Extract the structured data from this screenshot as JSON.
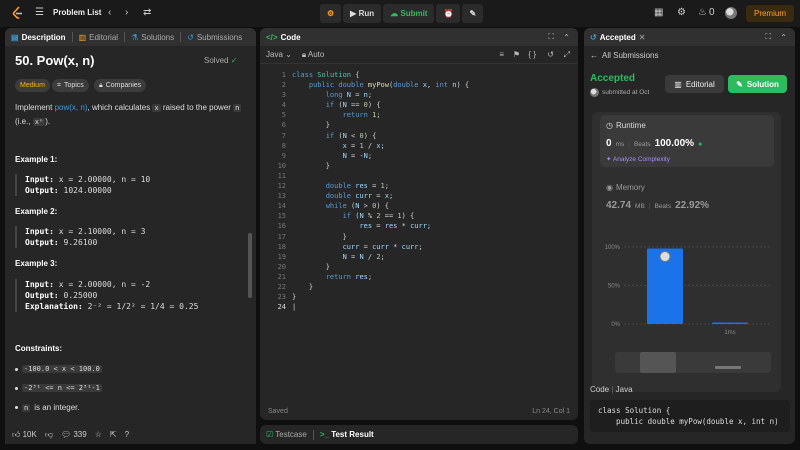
{
  "topbar": {
    "problem_list_label": "Problem List",
    "run_label": "Run",
    "submit_label": "Submit",
    "streak_count": "0",
    "premium_label": "Premium"
  },
  "description": {
    "tabs": [
      {
        "label": "Description",
        "active": true
      },
      {
        "label": "Editorial",
        "active": false
      },
      {
        "label": "Solutions",
        "active": false
      },
      {
        "label": "Submissions",
        "active": false
      }
    ],
    "title": "50. Pow(x, n)",
    "solved_label": "Solved",
    "chips": {
      "difficulty": "Medium",
      "topics": "Topics",
      "companies": "Companies"
    },
    "intro_prefix": "Implement",
    "intro_link": "pow(x, n)",
    "intro_mid": ", which calculates",
    "intro_x": "x",
    "intro_mid2": "raised to the power",
    "intro_n": "n",
    "intro_suffix_prefix": "(i.e.,",
    "intro_xn": "xⁿ",
    "intro_suffix": ").",
    "examples": [
      {
        "title": "Example 1:",
        "input": "x = 2.00000, n = 10",
        "output": "1024.00000",
        "explanation": ""
      },
      {
        "title": "Example 2:",
        "input": "x = 2.10000, n = 3",
        "output": "9.26100",
        "explanation": ""
      },
      {
        "title": "Example 3:",
        "input": "x = 2.00000, n = -2",
        "output": "0.25000",
        "explanation": "2⁻² = 1/2² = 1/4 = 0.25"
      }
    ],
    "labels": {
      "input": "Input:",
      "output": "Output:",
      "explanation": "Explanation:"
    },
    "constraints_title": "Constraints:",
    "constraints": [
      "-100.0 < x < 100.0",
      "-2³¹ <= n <= 2³¹-1",
      "is an integer."
    ],
    "constraint_n": "n",
    "footer": {
      "likes": "10K",
      "comments": "339"
    }
  },
  "code": {
    "tab_label": "Code",
    "language": "Java",
    "mode": "Auto",
    "saved_label": "Saved",
    "cursor_pos": "Ln 24, Col 1",
    "line_numbers": [
      "1",
      "2",
      "3",
      "4",
      "5",
      "6",
      "7",
      "8",
      "9",
      "10",
      "11",
      "12",
      "13",
      "14",
      "15",
      "16",
      "17",
      "18",
      "19",
      "20",
      "21",
      "22",
      "23",
      "24"
    ]
  },
  "bottom": {
    "testcase_label": "Testcase",
    "result_label": "Test Result"
  },
  "result": {
    "tab_label": "Accepted",
    "all_submissions": "All Submissions",
    "status": "Accepted",
    "submitted_at": "submitted at Oct",
    "editorial_btn": "Editorial",
    "solution_btn": "Solution",
    "runtime_label": "Runtime",
    "runtime_value": "0",
    "runtime_unit": "ms",
    "beats_label": "Beats",
    "runtime_beats": "100.00%",
    "analyze": "Analyze Complexity",
    "memory_label": "Memory",
    "memory_value": "42.74",
    "memory_unit": "MB",
    "memory_beats": "22.92%",
    "code_header_label": "Code",
    "code_header_lang": "Java",
    "code_preview": "class Solution {\n    public double myPow(double x, int n)"
  },
  "chart_data": {
    "type": "bar",
    "categories": [
      "0ms",
      "1ms"
    ],
    "values": [
      98,
      2
    ],
    "yticks": [
      "100%",
      "50%",
      "0%"
    ],
    "ylim": [
      0,
      100
    ],
    "xtick_label": "1ms",
    "color": "#1a73e8"
  },
  "colors": {
    "accent_green": "#2cbb5d",
    "accent_orange": "#ffa116",
    "chart_blue": "#1a73e8"
  }
}
